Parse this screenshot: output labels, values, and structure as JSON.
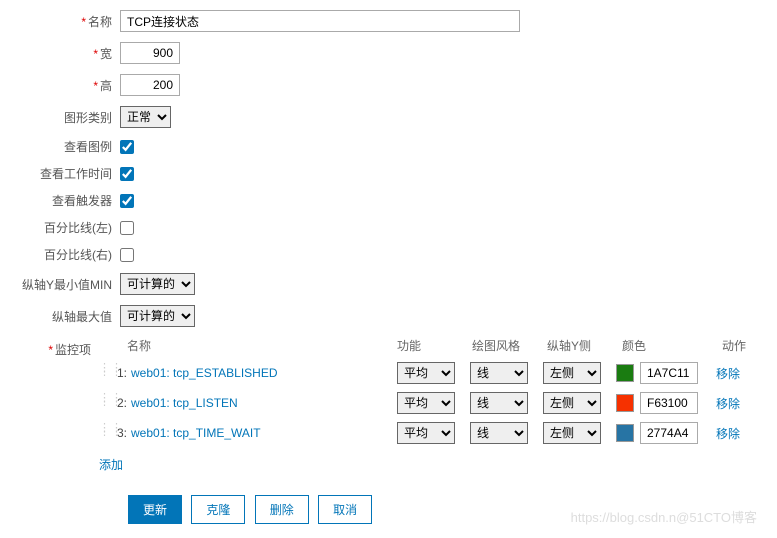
{
  "labels": {
    "name": "名称",
    "width": "宽",
    "height": "高",
    "graphType": "图形类别",
    "showLegend": "查看图例",
    "showWorkTime": "查看工作时间",
    "showTriggers": "查看触发器",
    "percentLeft": "百分比线(左)",
    "percentRight": "百分比线(右)",
    "yMin": "纵轴Y最小值MIN",
    "yMax": "纵轴最大值",
    "monitorItems": "监控项"
  },
  "values": {
    "name": "TCP连接状态",
    "width": "900",
    "height": "200",
    "graphType": "正常",
    "yMin": "可计算的",
    "yMax": "可计算的"
  },
  "itemsHeader": {
    "name": "名称",
    "func": "功能",
    "style": "绘图风格",
    "yside": "纵轴Y侧",
    "color": "颜色",
    "action": "动作"
  },
  "items": [
    {
      "idx": "1:",
      "name": "web01: tcp_ESTABLISHED",
      "func": "平均",
      "style": "线",
      "yside": "左侧",
      "color": "1A7C11",
      "swatch": "#1A7C11"
    },
    {
      "idx": "2:",
      "name": "web01: tcp_LISTEN",
      "func": "平均",
      "style": "线",
      "yside": "左侧",
      "color": "F63100",
      "swatch": "#F63100"
    },
    {
      "idx": "3:",
      "name": "web01: tcp_TIME_WAIT",
      "func": "平均",
      "style": "线",
      "yside": "左侧",
      "color": "2774A4",
      "swatch": "#2774A4"
    }
  ],
  "actions": {
    "remove": "移除",
    "add": "添加"
  },
  "buttons": {
    "update": "更新",
    "clone": "克隆",
    "delete": "删除",
    "cancel": "取消"
  },
  "watermark": "https://blog.csdn.n@51CTO博客"
}
